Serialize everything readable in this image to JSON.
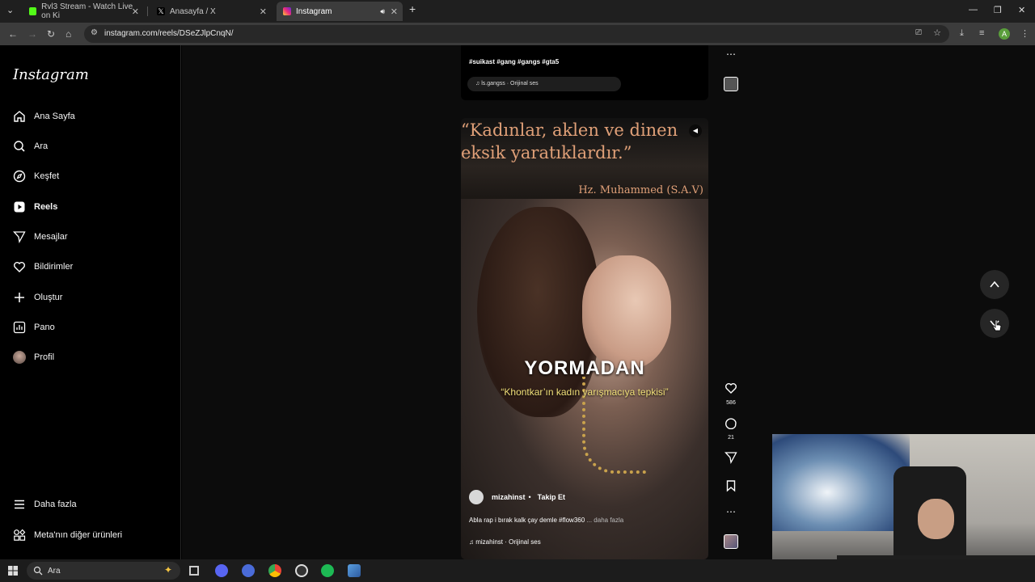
{
  "browser": {
    "tabs": [
      {
        "title": "Rvl3 Stream - Watch Live on Ki",
        "active": false
      },
      {
        "title": "Anasayfa / X",
        "active": false
      },
      {
        "title": "Instagram",
        "active": true
      }
    ],
    "new_tab_glyph": "+",
    "url": "instagram.com/reels/DSeZJlpCnqN/"
  },
  "sidebar": {
    "logo": "Instagram",
    "items": [
      {
        "label": "Ana Sayfa",
        "icon": "home-icon"
      },
      {
        "label": "Ara",
        "icon": "search-icon"
      },
      {
        "label": "Keşfet",
        "icon": "explore-icon"
      },
      {
        "label": "Reels",
        "icon": "reels-icon",
        "active": true
      },
      {
        "label": "Mesajlar",
        "icon": "messages-icon"
      },
      {
        "label": "Bildirimler",
        "icon": "heart-icon"
      },
      {
        "label": "Oluştur",
        "icon": "plus-icon"
      },
      {
        "label": "Pano",
        "icon": "dashboard-icon"
      },
      {
        "label": "Profil",
        "icon": "profile-avatar"
      }
    ],
    "bottom": [
      {
        "label": "Daha fazla",
        "icon": "menu-icon"
      },
      {
        "label": "Meta'nın diğer ürünleri",
        "icon": "meta-grid-icon"
      }
    ]
  },
  "prev_reel": {
    "hashtags": "#suikast #gang #gangs #gta5",
    "audio": "ls.gangss · Orijinal ses"
  },
  "reel": {
    "quote_line1": "“Kadınlar, aklen ve dinen",
    "quote_line2": "eksik yaratıklardır.”",
    "quote_author": "Hz. Muhammed (S.A.V)",
    "overlay_title": "YORMADAN",
    "overlay_subtitle": "“Khontkar’ın kadın yarışmacıya tepkisi”",
    "author": "mizahinst",
    "follow_label": "Takip Et",
    "caption": "Abla rap i bırak kalk çay demle #flow360",
    "caption_more": " ... daha fazla",
    "audio": "mizahinst · Orijinal ses",
    "likes": "586",
    "comments": "21"
  },
  "taskbar": {
    "search_placeholder": "Ara"
  },
  "colors": {
    "accent_quote": "#e0a078",
    "subtitle_yellow": "#f2e07a"
  }
}
